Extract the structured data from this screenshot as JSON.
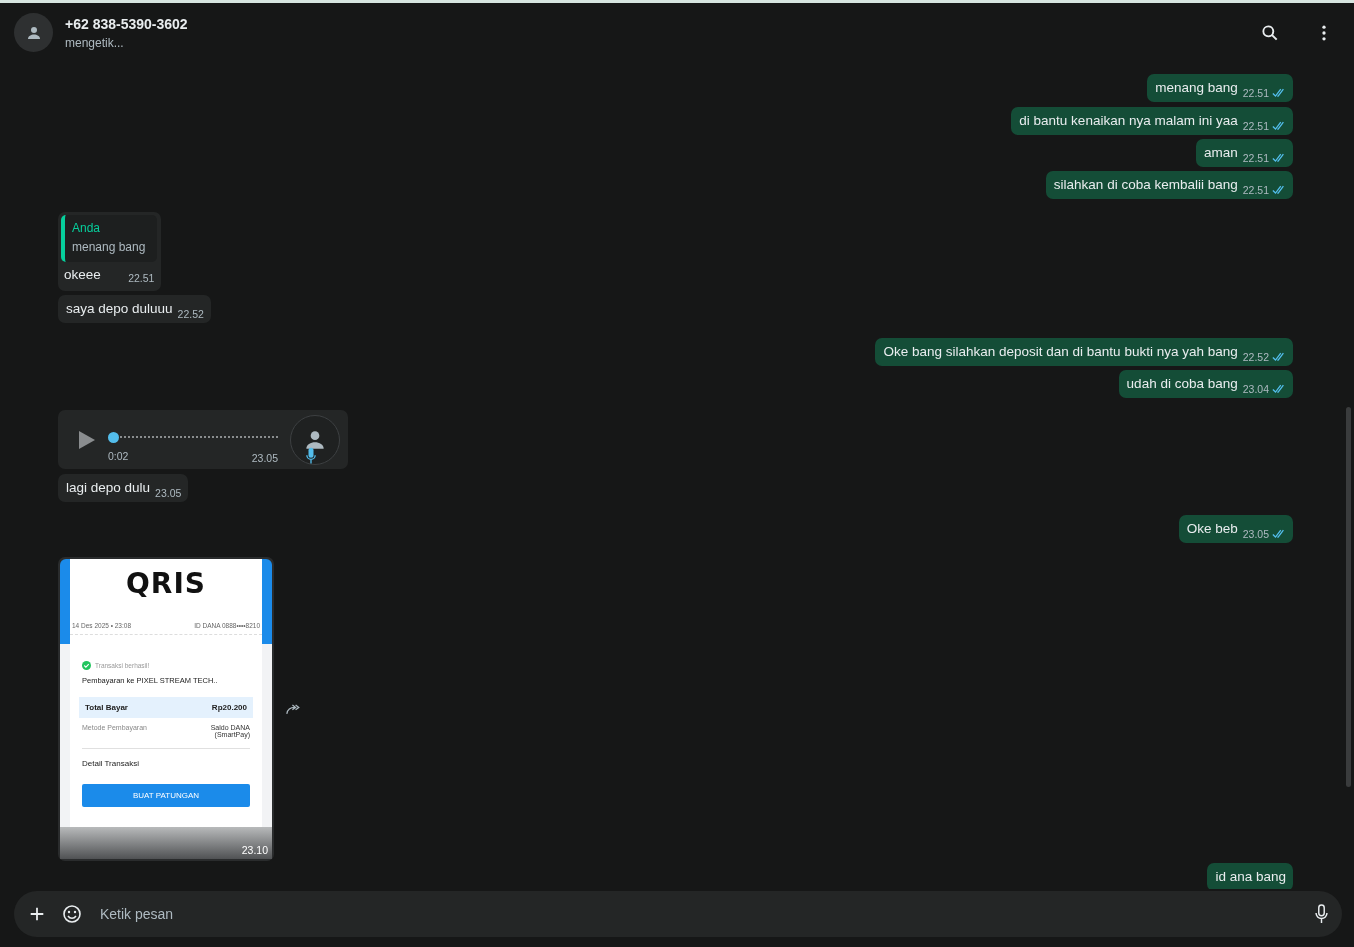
{
  "header": {
    "name": "+62 838-5390-3602",
    "status": "mengetik..."
  },
  "messages": [
    {
      "kind": "text",
      "outgoing": true,
      "text": "menang bang",
      "time": "22.51",
      "read": true
    },
    {
      "kind": "text",
      "outgoing": true,
      "text": "di bantu kenaikan nya malam ini yaa",
      "time": "22.51",
      "read": true
    },
    {
      "kind": "text",
      "outgoing": true,
      "text": "aman",
      "time": "22.51",
      "read": true
    },
    {
      "kind": "text",
      "outgoing": true,
      "text": "silahkan di coba kembalii bang",
      "time": "22.51",
      "read": true
    },
    {
      "kind": "quote",
      "outgoing": false,
      "quote_author": "Anda",
      "quote_text": "menang bang",
      "text": "okeee",
      "time": "22.51"
    },
    {
      "kind": "text",
      "outgoing": false,
      "text": "saya depo duluuu",
      "time": "22.52"
    },
    {
      "kind": "text",
      "outgoing": true,
      "text": "Oke bang silahkan deposit dan di bantu bukti nya yah bang",
      "time": "22.52",
      "read": true
    },
    {
      "kind": "text",
      "outgoing": true,
      "text": "udah di coba bang",
      "time": "23.04",
      "read": true
    },
    {
      "kind": "voice",
      "outgoing": false,
      "duration": "0:02",
      "time": "23.05",
      "level": 0
    },
    {
      "kind": "text",
      "outgoing": false,
      "text": "lagi depo dulu",
      "time": "23.05"
    },
    {
      "kind": "text",
      "outgoing": true,
      "text": "Oke beb",
      "time": "23.05",
      "read": true
    },
    {
      "kind": "image",
      "outgoing": false,
      "time": "23.10",
      "receipt": {
        "logo": "QRIS",
        "date": "14 Des 2025 • 23:08",
        "account": "ID DANA 0888••••8210",
        "status": "Transaksi berhasil!",
        "payee": "Pembayaran ke PIXEL STREAM TECH..",
        "total_label": "Total Bayar",
        "total": "Rp20.200",
        "method_label": "Metode Pembayaran",
        "method": "Saldo DANA (SmartPay)",
        "details": "Detail Transaksi",
        "button": "BUAT PATUNGAN"
      }
    },
    {
      "kind": "text",
      "outgoing": true,
      "text": "id ana bang"
    }
  ],
  "composer": {
    "placeholder": "Ketik pesan"
  }
}
